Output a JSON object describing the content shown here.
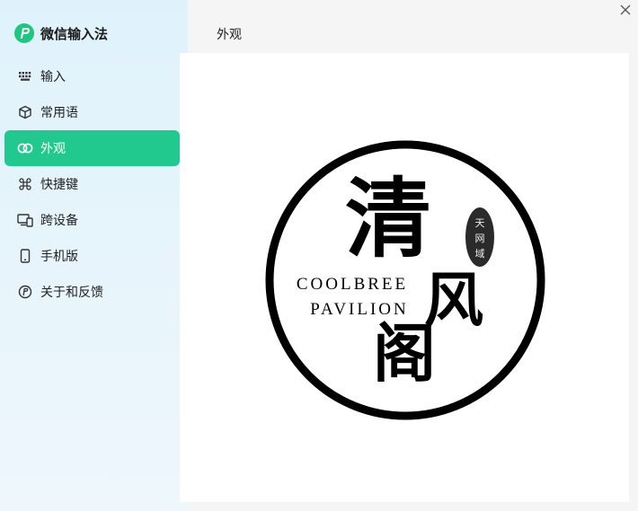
{
  "app": {
    "title": "微信输入法"
  },
  "sidebar": {
    "items": [
      {
        "label": "输入",
        "icon": "keyboard-icon"
      },
      {
        "label": "常用语",
        "icon": "cube-icon"
      },
      {
        "label": "外观",
        "icon": "appearance-icon",
        "active": true
      },
      {
        "label": "快捷键",
        "icon": "command-key-icon"
      },
      {
        "label": "跨设备",
        "icon": "devices-icon"
      },
      {
        "label": "手机版",
        "icon": "phone-icon"
      },
      {
        "label": "关于和反馈",
        "icon": "about-icon"
      }
    ]
  },
  "page": {
    "title": "外观"
  },
  "image": {
    "big_char_1": "清",
    "big_char_2": "风",
    "big_char_3": "阁",
    "line_1": "COOLBREE",
    "line_2": "PAVILION",
    "stamp_1": "天",
    "stamp_2": "网",
    "stamp_3": "域"
  },
  "colors": {
    "accent": "#22c98e",
    "logo_green": "#1ec67f"
  }
}
